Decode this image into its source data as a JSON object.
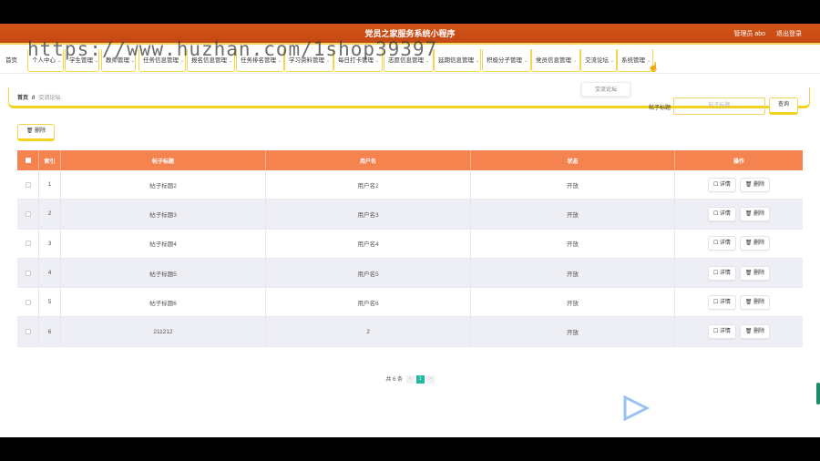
{
  "app": {
    "title": "党员之家服务系统小程序",
    "user_label": "管理员 abo",
    "logout_label": "退出登录",
    "accent_color": "#c44812",
    "header_color": "#f58350",
    "highlight_color": "#f2d11f"
  },
  "nav": {
    "items": [
      {
        "label": "首页",
        "has_menu": false
      },
      {
        "label": "个人中心",
        "has_menu": true
      },
      {
        "label": "学生管理",
        "has_menu": true
      },
      {
        "label": "教师管理",
        "has_menu": true
      },
      {
        "label": "任务信息管理",
        "has_menu": true
      },
      {
        "label": "报名信息管理",
        "has_menu": true
      },
      {
        "label": "任务排名管理",
        "has_menu": true
      },
      {
        "label": "学习资料管理",
        "has_menu": true
      },
      {
        "label": "每日打卡管理",
        "has_menu": true
      },
      {
        "label": "志愿信息管理",
        "has_menu": true
      },
      {
        "label": "延期信息管理",
        "has_menu": true
      },
      {
        "label": "积极分子管理",
        "has_menu": true
      },
      {
        "label": "党员信息管理",
        "has_menu": true
      },
      {
        "label": "交流论坛",
        "has_menu": true
      },
      {
        "label": "系统管理",
        "has_menu": true
      }
    ],
    "dropdown_item": "交流论坛"
  },
  "watermark": "https://www.huzhan.com/1shop39397",
  "breadcrumb": {
    "home": "首页",
    "sep": "//",
    "current": "交流论坛"
  },
  "search": {
    "label": "帖子标题",
    "placeholder": "帖子标题",
    "button": "查询"
  },
  "toolbar": {
    "delete_label": "删除",
    "delete_icon": "trash-icon"
  },
  "table": {
    "columns": [
      "索引",
      "帖子标题",
      "用户名",
      "状态",
      "操作"
    ],
    "rows": [
      {
        "index": "1",
        "title": "帖子标题2",
        "user": "用户名2",
        "status": "开放"
      },
      {
        "index": "2",
        "title": "帖子标题3",
        "user": "用户名3",
        "status": "开放"
      },
      {
        "index": "3",
        "title": "帖子标题4",
        "user": "用户名4",
        "status": "开放"
      },
      {
        "index": "4",
        "title": "帖子标题5",
        "user": "用户名5",
        "status": "开放"
      },
      {
        "index": "5",
        "title": "帖子标题6",
        "user": "用户名6",
        "status": "开放"
      },
      {
        "index": "6",
        "title": "211212",
        "user": "2",
        "status": "开放"
      }
    ],
    "detail_label": "详情",
    "delete_label": "删除"
  },
  "pagination": {
    "total_text": "共 6 条",
    "prev": "<",
    "current": "1",
    "next": ">"
  }
}
